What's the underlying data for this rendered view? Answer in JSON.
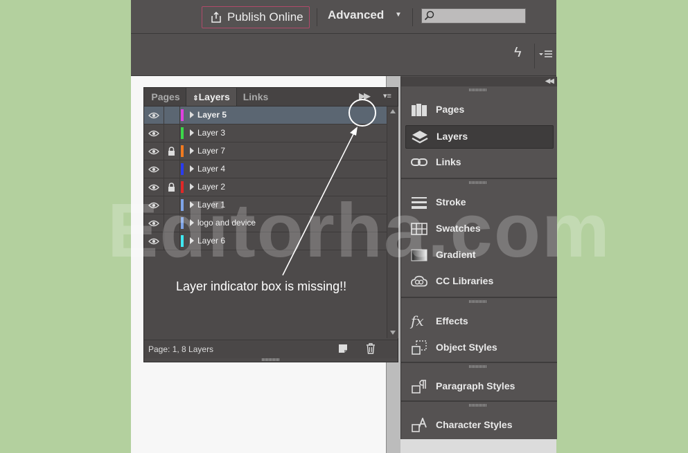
{
  "topbar": {
    "publish_label": "Publish Online",
    "workspace_label": "Advanced",
    "search_placeholder": ""
  },
  "layers_panel": {
    "tabs": [
      {
        "label": "Pages",
        "active": false
      },
      {
        "label": "Layers",
        "active": true
      },
      {
        "label": "Links",
        "active": false
      }
    ],
    "layers": [
      {
        "name": "Layer 5",
        "color": "#e040e0",
        "visible": true,
        "locked": false,
        "selected": true
      },
      {
        "name": "Layer 3",
        "color": "#3cd84a",
        "visible": true,
        "locked": false,
        "selected": false
      },
      {
        "name": "Layer 7",
        "color": "#f07a20",
        "visible": true,
        "locked": true,
        "selected": false
      },
      {
        "name": "Layer 4",
        "color": "#2a3cf0",
        "visible": true,
        "locked": false,
        "selected": false
      },
      {
        "name": "Layer 2",
        "color": "#e02828",
        "visible": true,
        "locked": true,
        "selected": false
      },
      {
        "name": "Layer 1",
        "color": "#7ea4e8",
        "visible": true,
        "locked": false,
        "selected": false
      },
      {
        "name": "logo and device",
        "color": "#7ea4e8",
        "visible": true,
        "locked": false,
        "selected": false
      },
      {
        "name": "Layer 6",
        "color": "#40e8f0",
        "visible": true,
        "locked": false,
        "selected": false
      }
    ],
    "status": "Page: 1, 8 Layers"
  },
  "annotation": {
    "text": "Layer indicator box is missing!!"
  },
  "watermark": "Editorha.com",
  "dock": {
    "groups": [
      {
        "items": [
          {
            "label": "Pages",
            "icon": "pages-icon",
            "active": false
          },
          {
            "label": "Layers",
            "icon": "layers-icon",
            "active": true
          },
          {
            "label": "Links",
            "icon": "links-icon",
            "active": false
          }
        ]
      },
      {
        "items": [
          {
            "label": "Stroke",
            "icon": "stroke-icon",
            "active": false
          },
          {
            "label": "Swatches",
            "icon": "swatches-icon",
            "active": false
          },
          {
            "label": "Gradient",
            "icon": "gradient-icon",
            "active": false
          },
          {
            "label": "CC Libraries",
            "icon": "cc-libraries-icon",
            "active": false
          }
        ]
      },
      {
        "items": [
          {
            "label": "Effects",
            "icon": "effects-icon",
            "active": false
          },
          {
            "label": "Object Styles",
            "icon": "object-styles-icon",
            "active": false
          }
        ]
      },
      {
        "items": [
          {
            "label": "Paragraph Styles",
            "icon": "paragraph-styles-icon",
            "active": false
          }
        ]
      },
      {
        "items": [
          {
            "label": "Character Styles",
            "icon": "character-styles-icon",
            "active": false
          }
        ]
      }
    ]
  }
}
